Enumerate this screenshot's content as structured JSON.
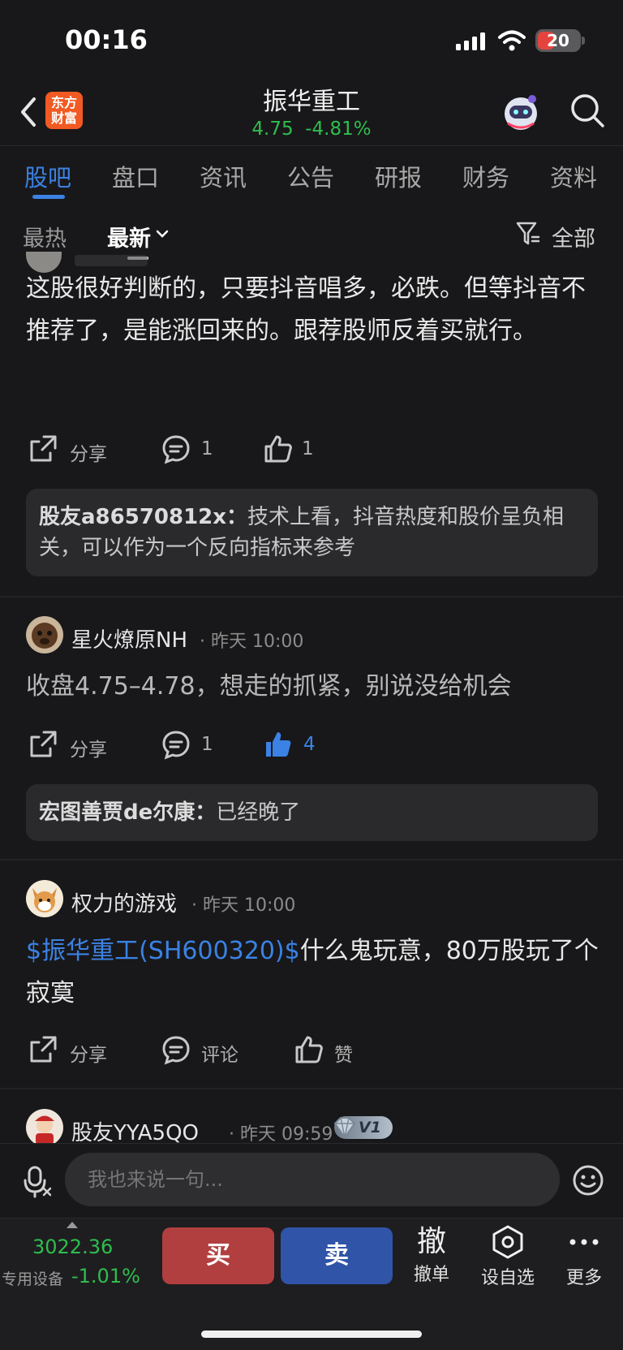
{
  "status_bar": {
    "time": "00:16",
    "battery": "20"
  },
  "header": {
    "logo_text_line1": "东方",
    "logo_text_line2": "财富",
    "stock_name": "振华重工",
    "price": "4.75",
    "change_pct": "-4.81%"
  },
  "tabs": [
    "股吧",
    "盘口",
    "资讯",
    "公告",
    "研报",
    "财务",
    "资料"
  ],
  "sort": {
    "hot": "最热",
    "new": "最新",
    "filter": "全部"
  },
  "posts": [
    {
      "text": "这股很好判断的，只要抖音唱多，必跌。但等抖音不推荐了，是能涨回来的。跟荐股师反着买就行。",
      "share": "分享",
      "comments": "1",
      "likes": "1",
      "reply_user": "股友a86570812x：",
      "reply_text": "技术上看，抖音热度和股价呈负相关，可以作为一个反向指标来参考"
    },
    {
      "username": "星火燎原NH",
      "time": "昨天 10:00",
      "text": "收盘4.75–4.78，想走的抓紧，别说没给机会",
      "share": "分享",
      "comments": "1",
      "likes": "4",
      "reply_user": "宏图善贾de尔康：",
      "reply_text": "已经晚了"
    },
    {
      "username": "权力的游戏",
      "time": "昨天 10:00",
      "link_text": "$振华重工(SH600320)$",
      "text": "什么鬼玩意，80万股玩了个寂寞",
      "share": "分享",
      "comment_label": "评论",
      "like_label": "赞"
    },
    {
      "username": "股友YYA5QO",
      "time": "昨天 09:59",
      "badge": "V1"
    }
  ],
  "comment_bar": {
    "placeholder": "我也来说一句..."
  },
  "bottom_bar": {
    "index_value": "3022.36",
    "index_label": "专用设备",
    "index_change": "-1.01%",
    "buy": "买",
    "sell": "卖",
    "cancel_glyph": "撤",
    "cancel_label": "撤单",
    "watchlist_label": "设自选",
    "more_label": "更多"
  },
  "colors": {
    "accent": "#3b82e4",
    "down_green": "#2fbd4f",
    "buy_red": "#b23f3f",
    "sell_blue": "#3054a8"
  }
}
